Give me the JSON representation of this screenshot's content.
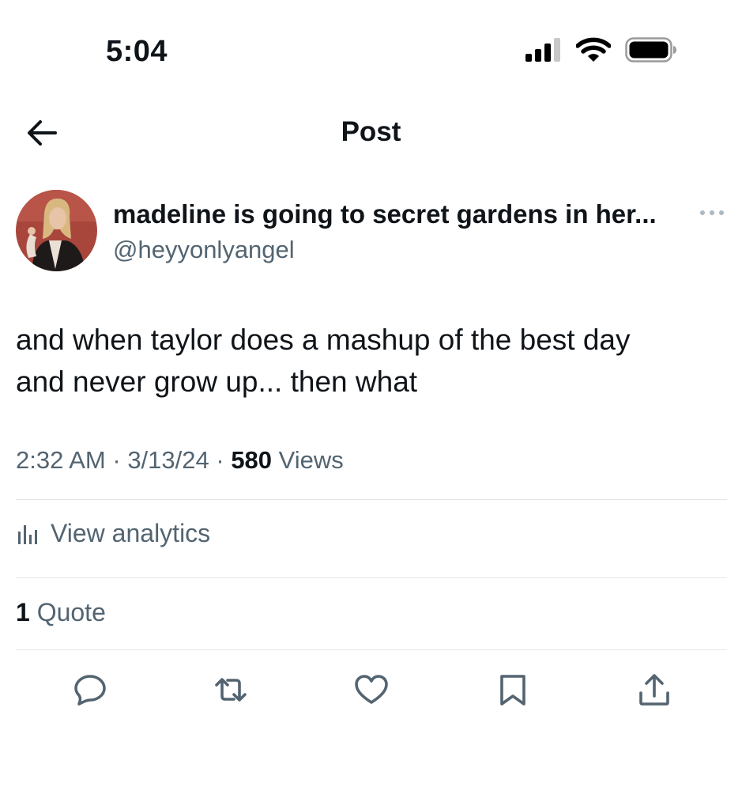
{
  "status_bar": {
    "time": "5:04"
  },
  "header": {
    "title": "Post"
  },
  "author": {
    "display_name": "madeline is going to secret gardens in her...",
    "handle": "@heyyonlyangel"
  },
  "tweet": {
    "text_line1": "and when taylor does a mashup of the best day",
    "text_line2": "and never grow up... then what",
    "time": "2:32 AM",
    "date": "3/13/24",
    "views_count": "580",
    "views_label": "Views"
  },
  "analytics": {
    "label": "View analytics"
  },
  "quotes": {
    "count": "1",
    "label": "Quote"
  },
  "colors": {
    "text": "#0f1419",
    "secondary": "#536471",
    "divider": "#e3e6e8"
  }
}
